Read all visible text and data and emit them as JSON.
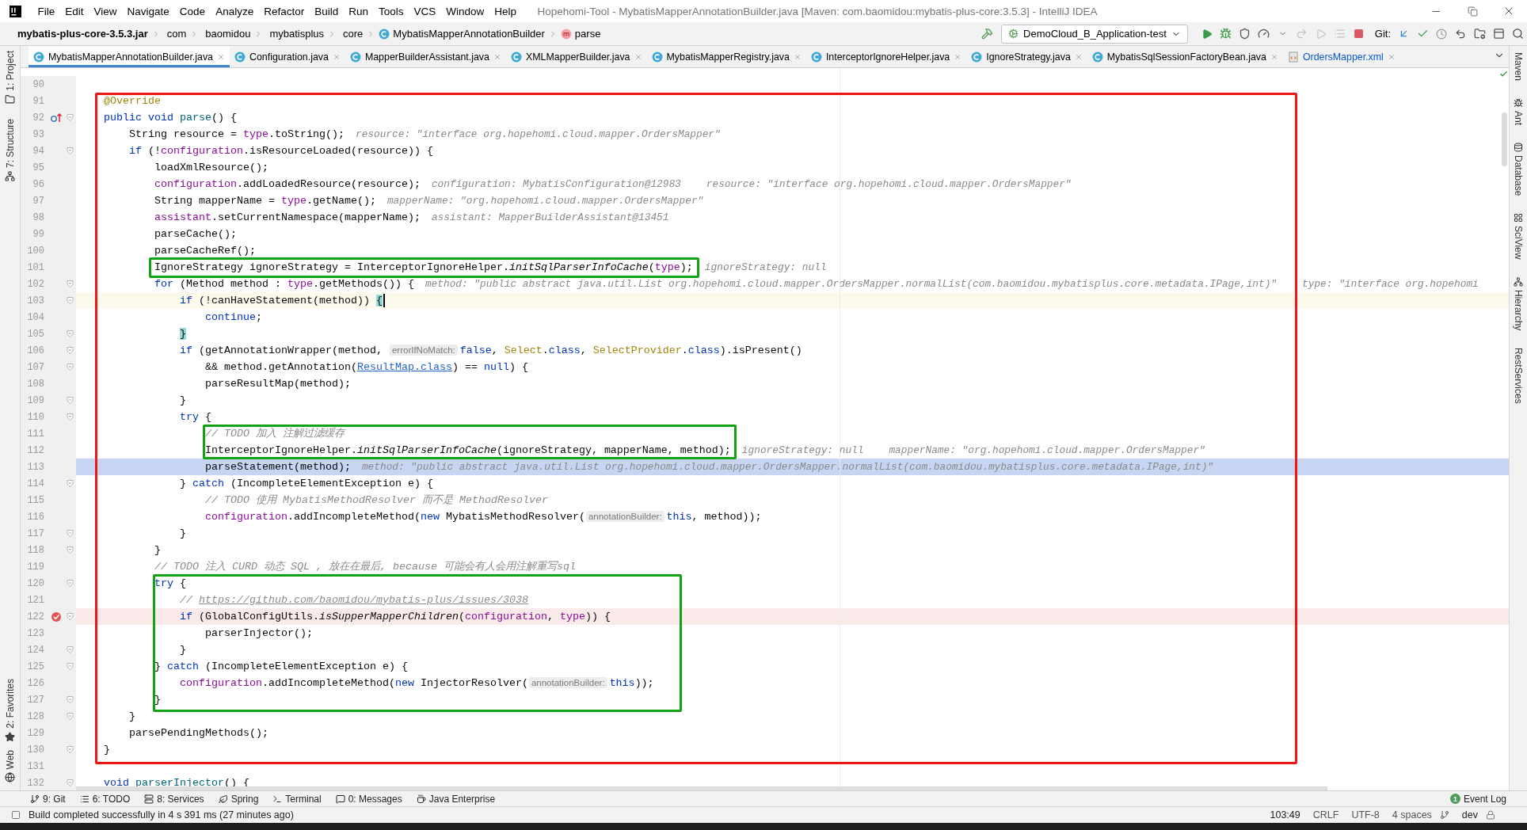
{
  "window": {
    "title": "Hopehomi-Tool - MybatisMapperAnnotationBuilder.java [Maven: com.baomidou:mybatis-plus-core:3.5.3] - IntelliJ IDEA"
  },
  "menu": [
    "File",
    "Edit",
    "View",
    "Navigate",
    "Code",
    "Analyze",
    "Refactor",
    "Build",
    "Run",
    "Tools",
    "VCS",
    "Window",
    "Help"
  ],
  "breadcrumbs": [
    {
      "kind": "jar",
      "text": "mybatis-plus-core-3.5.3.jar"
    },
    {
      "kind": "package",
      "text": "com"
    },
    {
      "kind": "package",
      "text": "baomidou"
    },
    {
      "kind": "package",
      "text": "mybatisplus"
    },
    {
      "kind": "package",
      "text": "core"
    },
    {
      "kind": "class",
      "text": "MybatisMapperAnnotationBuilder"
    },
    {
      "kind": "method",
      "text": "parse"
    }
  ],
  "run_config": {
    "name": "DemoCloud_B_Application-test"
  },
  "vcs_label": "Git:",
  "tabs": [
    {
      "label": "MybatisMapperAnnotationBuilder.java",
      "kind": "class",
      "selected": true,
      "modified": false
    },
    {
      "label": "Configuration.java",
      "kind": "class",
      "selected": false,
      "modified": false
    },
    {
      "label": "MapperBuilderAssistant.java",
      "kind": "class",
      "selected": false,
      "modified": false
    },
    {
      "label": "XMLMapperBuilder.java",
      "kind": "class",
      "selected": false,
      "modified": false
    },
    {
      "label": "MybatisMapperRegistry.java",
      "kind": "class",
      "selected": false,
      "modified": false
    },
    {
      "label": "InterceptorIgnoreHelper.java",
      "kind": "class",
      "selected": false,
      "modified": false
    },
    {
      "label": "IgnoreStrategy.java",
      "kind": "class",
      "selected": false,
      "modified": false
    },
    {
      "label": "MybatisSqlSessionFactoryBean.java",
      "kind": "class",
      "selected": false,
      "modified": false
    },
    {
      "label": "OrdersMapper.xml",
      "kind": "xml",
      "selected": false,
      "modified": true
    }
  ],
  "left_tools_top": [
    {
      "label": "1: Project",
      "kind": "project"
    },
    {
      "label": "7: Structure",
      "kind": "structure"
    }
  ],
  "left_tools_bottom": [
    {
      "label": "2: Favorites",
      "kind": "favorites"
    },
    {
      "label": "Web",
      "kind": "web"
    }
  ],
  "right_tools": [
    {
      "label": "Maven",
      "kind": "maven"
    },
    {
      "label": "Ant",
      "kind": "ant"
    },
    {
      "label": "Database",
      "kind": "database"
    },
    {
      "label": "SciView",
      "kind": "sciview"
    },
    {
      "label": "Hierarchy",
      "kind": "hierarchy"
    },
    {
      "label": "RestServices",
      "kind": "rest"
    }
  ],
  "editor": {
    "lines": [
      {
        "number": "90",
        "fold": false,
        "kind": "plain"
      },
      {
        "number": "91",
        "fold": false,
        "kind": "plain",
        "tokens": [
          {
            "kind": "ann",
            "text": "    @Override"
          }
        ]
      },
      {
        "number": "92",
        "fold": true,
        "kind": "override",
        "tokens": [
          {
            "kind": "kw",
            "text": "    public void "
          },
          {
            "kind": "decl",
            "text": "parse"
          },
          {
            "kind": "plain",
            "text": "() {"
          }
        ]
      },
      {
        "number": "93",
        "fold": false,
        "kind": "plain",
        "tokens": [
          {
            "kind": "plain",
            "text": "        String resource = "
          },
          {
            "kind": "field",
            "text": "type"
          },
          {
            "kind": "plain",
            "text": ".toString();"
          }
        ],
        "hints": [
          "resource: \"interface org.hopehomi.cloud.mapper.OrdersMapper\""
        ]
      },
      {
        "number": "94",
        "fold": true,
        "kind": "plain",
        "tokens": [
          {
            "kind": "kw",
            "text": "        if"
          },
          {
            "kind": "plain",
            "text": " (!"
          },
          {
            "kind": "field",
            "text": "configuration"
          },
          {
            "kind": "plain",
            "text": ".isResourceLoaded(resource)) {"
          }
        ]
      },
      {
        "number": "95",
        "fold": false,
        "kind": "plain",
        "tokens": [
          {
            "kind": "plain",
            "text": "            loadXmlResource();"
          }
        ]
      },
      {
        "number": "96",
        "fold": false,
        "kind": "plain",
        "tokens": [
          {
            "kind": "field",
            "text": "            configuration"
          },
          {
            "kind": "plain",
            "text": ".addLoadedResource(resource);"
          }
        ],
        "hints": [
          "configuration: MybatisConfiguration@12983",
          "resource: \"interface org.hopehomi.cloud.mapper.OrdersMapper\""
        ]
      },
      {
        "number": "97",
        "fold": false,
        "kind": "plain",
        "tokens": [
          {
            "kind": "plain",
            "text": "            String mapperName = "
          },
          {
            "kind": "field",
            "text": "type"
          },
          {
            "kind": "plain",
            "text": ".getName();"
          }
        ],
        "hints": [
          "mapperName: \"org.hopehomi.cloud.mapper.OrdersMapper\""
        ]
      },
      {
        "number": "98",
        "fold": false,
        "kind": "plain",
        "tokens": [
          {
            "kind": "field",
            "text": "            assistant"
          },
          {
            "kind": "plain",
            "text": ".setCurrentNamespace(mapperName);"
          }
        ],
        "hints": [
          "assistant: MapperBuilderAssistant@13451"
        ]
      },
      {
        "number": "99",
        "fold": false,
        "kind": "plain",
        "tokens": [
          {
            "kind": "plain",
            "text": "            parseCache();"
          }
        ]
      },
      {
        "number": "100",
        "fold": false,
        "kind": "plain",
        "tokens": [
          {
            "kind": "plain",
            "text": "            parseCacheRef();"
          }
        ]
      },
      {
        "number": "101",
        "fold": false,
        "kind": "plain",
        "tokens": [
          {
            "kind": "plain",
            "text": "            IgnoreStrategy ignoreStrategy = InterceptorIgnoreHelper."
          },
          {
            "kind": "static",
            "text": "initSqlParserInfoCache"
          },
          {
            "kind": "plain",
            "text": "("
          },
          {
            "kind": "field",
            "text": "type"
          },
          {
            "kind": "plain",
            "text": ");"
          }
        ],
        "hints": [
          "ignoreStrategy: null"
        ]
      },
      {
        "number": "102",
        "fold": true,
        "kind": "plain",
        "tokens": [
          {
            "kind": "kw",
            "text": "            for"
          },
          {
            "kind": "plain",
            "text": " (Method method : "
          },
          {
            "kind": "field",
            "text": "type"
          },
          {
            "kind": "plain",
            "text": ".getMethods()) {"
          }
        ],
        "hints": [
          "method: \"public abstract java.util.List org.hopehomi.cloud.mapper.OrdersMapper.normalList(com.baomidou.mybatisplus.core.metadata.IPage,int)\"",
          "type: \"interface org.hopehomi"
        ]
      },
      {
        "number": "103",
        "fold": true,
        "kind": "caret",
        "tokens": [
          {
            "kind": "kw",
            "text": "                if"
          },
          {
            "kind": "plain",
            "text": " (!canHaveStatement(method)) "
          },
          {
            "kind": "brace",
            "text": "{"
          }
        ]
      },
      {
        "number": "104",
        "fold": false,
        "kind": "plain",
        "tokens": [
          {
            "kind": "kw",
            "text": "                    continue"
          },
          {
            "kind": "plain",
            "text": ";"
          }
        ]
      },
      {
        "number": "105",
        "fold": true,
        "kind": "plain",
        "tokens": [
          {
            "kind": "brace",
            "text": "                }"
          }
        ]
      },
      {
        "number": "106",
        "fold": true,
        "kind": "plain",
        "tokens": [
          {
            "kind": "kw",
            "text": "                if"
          },
          {
            "kind": "plain",
            "text": " (getAnnotationWrapper(method, "
          },
          {
            "kind": "param",
            "text": "errorIfNoMatch:"
          },
          {
            "kind": "kw",
            "text": "false"
          },
          {
            "kind": "plain",
            "text": ", "
          },
          {
            "kind": "ann",
            "text": "Select"
          },
          {
            "kind": "plain",
            "text": "."
          },
          {
            "kind": "kw",
            "text": "class"
          },
          {
            "kind": "plain",
            "text": ", "
          },
          {
            "kind": "ann",
            "text": "SelectProvider"
          },
          {
            "kind": "plain",
            "text": "."
          },
          {
            "kind": "kw",
            "text": "class"
          },
          {
            "kind": "plain",
            "text": ").isPresent()"
          }
        ]
      },
      {
        "number": "107",
        "fold": true,
        "kind": "plain",
        "tokens": [
          {
            "kind": "plain",
            "text": "                    && method.getAnnotation("
          },
          {
            "kind": "link",
            "text": "ResultMap.class"
          },
          {
            "kind": "plain",
            "text": ") == "
          },
          {
            "kind": "kw",
            "text": "null"
          },
          {
            "kind": "plain",
            "text": ") {"
          }
        ]
      },
      {
        "number": "108",
        "fold": false,
        "kind": "plain",
        "tokens": [
          {
            "kind": "plain",
            "text": "                    parseResultMap(method);"
          }
        ]
      },
      {
        "number": "109",
        "fold": true,
        "kind": "plain",
        "tokens": [
          {
            "kind": "plain",
            "text": "                }"
          }
        ]
      },
      {
        "number": "110",
        "fold": true,
        "kind": "plain",
        "tokens": [
          {
            "kind": "kw",
            "text": "                try"
          },
          {
            "kind": "plain",
            "text": " {"
          }
        ]
      },
      {
        "number": "111",
        "fold": false,
        "kind": "plain",
        "tokens": [
          {
            "kind": "comment",
            "text": "                    // TODO 加入 注解过滤缓存"
          }
        ]
      },
      {
        "number": "112",
        "fold": false,
        "kind": "plain",
        "tokens": [
          {
            "kind": "plain",
            "text": "                    InterceptorIgnoreHelper."
          },
          {
            "kind": "static",
            "text": "initSqlParserInfoCache"
          },
          {
            "kind": "plain",
            "text": "(ignoreStrategy, mapperName, method);"
          }
        ],
        "hints": [
          "ignoreStrategy: null",
          "mapperName: \"org.hopehomi.cloud.mapper.OrdersMapper\""
        ]
      },
      {
        "number": "113",
        "fold": false,
        "kind": "exec",
        "tokens": [
          {
            "kind": "plain",
            "text": "                    parseStatement(method);"
          }
        ],
        "hints": [
          "method: \"public abstract java.util.List org.hopehomi.cloud.mapper.OrdersMapper.normalList(com.baomidou.mybatisplus.core.metadata.IPage,int)\""
        ]
      },
      {
        "number": "114",
        "fold": true,
        "kind": "plain",
        "tokens": [
          {
            "kind": "plain",
            "text": "                } "
          },
          {
            "kind": "kw",
            "text": "catch"
          },
          {
            "kind": "plain",
            "text": " (IncompleteElementException e) {"
          }
        ]
      },
      {
        "number": "115",
        "fold": false,
        "kind": "plain",
        "tokens": [
          {
            "kind": "comment",
            "text": "                    // TODO 使用 MybatisMethodResolver 而不是 MethodResolver"
          }
        ]
      },
      {
        "number": "116",
        "fold": false,
        "kind": "plain",
        "tokens": [
          {
            "kind": "field",
            "text": "                    configuration"
          },
          {
            "kind": "plain",
            "text": ".addIncompleteMethod("
          },
          {
            "kind": "kw",
            "text": "new"
          },
          {
            "kind": "plain",
            "text": " MybatisMethodResolver("
          },
          {
            "kind": "param",
            "text": "annotationBuilder:"
          },
          {
            "kind": "kw",
            "text": "this"
          },
          {
            "kind": "plain",
            "text": ", method));"
          }
        ]
      },
      {
        "number": "117",
        "fold": true,
        "kind": "plain",
        "tokens": [
          {
            "kind": "plain",
            "text": "                }"
          }
        ]
      },
      {
        "number": "118",
        "fold": true,
        "kind": "plain",
        "tokens": [
          {
            "kind": "plain",
            "text": "            }"
          }
        ]
      },
      {
        "number": "119",
        "fold": false,
        "kind": "plain",
        "tokens": [
          {
            "kind": "comment",
            "text": "            // TODO 注入 CURD 动态 SQL , 放在在最后, because 可能会有人会用注解重写sql"
          }
        ]
      },
      {
        "number": "120",
        "fold": true,
        "kind": "plain",
        "tokens": [
          {
            "kind": "kw",
            "text": "            try"
          },
          {
            "kind": "plain",
            "text": " {"
          }
        ]
      },
      {
        "number": "121",
        "fold": false,
        "kind": "plain",
        "tokens": [
          {
            "kind": "comment",
            "text": "                // "
          },
          {
            "kind": "comment-link",
            "text": "https://github.com/baomidou/mybatis-plus/issues/3038"
          }
        ]
      },
      {
        "number": "122",
        "fold": true,
        "kind": "breakpoint",
        "tokens": [
          {
            "kind": "kw",
            "text": "                if"
          },
          {
            "kind": "plain",
            "text": " (GlobalConfigUtils."
          },
          {
            "kind": "static",
            "text": "isSupperMapperChildren"
          },
          {
            "kind": "plain",
            "text": "("
          },
          {
            "kind": "field",
            "text": "configuration"
          },
          {
            "kind": "plain",
            "text": ", "
          },
          {
            "kind": "field",
            "text": "type"
          },
          {
            "kind": "plain",
            "text": ")) {"
          }
        ]
      },
      {
        "number": "123",
        "fold": false,
        "kind": "plain",
        "tokens": [
          {
            "kind": "plain",
            "text": "                    parserInjector();"
          }
        ]
      },
      {
        "number": "124",
        "fold": true,
        "kind": "plain",
        "tokens": [
          {
            "kind": "plain",
            "text": "                }"
          }
        ]
      },
      {
        "number": "125",
        "fold": true,
        "kind": "plain",
        "tokens": [
          {
            "kind": "plain",
            "text": "            } "
          },
          {
            "kind": "kw",
            "text": "catch"
          },
          {
            "kind": "plain",
            "text": " (IncompleteElementException e) {"
          }
        ]
      },
      {
        "number": "126",
        "fold": false,
        "kind": "plain",
        "tokens": [
          {
            "kind": "field",
            "text": "                configuration"
          },
          {
            "kind": "plain",
            "text": ".addIncompleteMethod("
          },
          {
            "kind": "kw",
            "text": "new"
          },
          {
            "kind": "plain",
            "text": " InjectorResolver("
          },
          {
            "kind": "param",
            "text": "annotationBuilder:"
          },
          {
            "kind": "kw",
            "text": "this"
          },
          {
            "kind": "plain",
            "text": "));"
          }
        ]
      },
      {
        "number": "127",
        "fold": true,
        "kind": "plain",
        "tokens": [
          {
            "kind": "plain",
            "text": "            }"
          }
        ]
      },
      {
        "number": "128",
        "fold": true,
        "kind": "plain",
        "tokens": [
          {
            "kind": "plain",
            "text": "        }"
          }
        ]
      },
      {
        "number": "129",
        "fold": false,
        "kind": "plain",
        "tokens": [
          {
            "kind": "plain",
            "text": "        parsePendingMethods();"
          }
        ]
      },
      {
        "number": "130",
        "fold": true,
        "kind": "plain",
        "tokens": [
          {
            "kind": "plain",
            "text": "    }"
          }
        ]
      },
      {
        "number": "131",
        "fold": false,
        "kind": "plain"
      },
      {
        "number": "132",
        "fold": true,
        "kind": "plain",
        "tokens": [
          {
            "kind": "kw",
            "text": "    void "
          },
          {
            "kind": "decl",
            "text": "parserInjector"
          },
          {
            "kind": "plain",
            "text": "() {"
          }
        ]
      }
    ]
  },
  "tool_windows": [
    {
      "label": "9: Git",
      "kind": "git"
    },
    {
      "label": "6: TODO",
      "kind": "todo"
    },
    {
      "label": "8: Services",
      "kind": "services"
    },
    {
      "label": "Spring",
      "kind": "spring"
    },
    {
      "label": "Terminal",
      "kind": "terminal"
    },
    {
      "label": "0: Messages",
      "kind": "messages"
    },
    {
      "label": "Java Enterprise",
      "kind": "enterprise"
    }
  ],
  "event_log": {
    "label": "Event Log",
    "count": "1"
  },
  "status": {
    "message": "Build completed successfully in 4 s 391 ms (27 minutes ago)",
    "position": "103:49",
    "line_separator": "CRLF",
    "encoding": "UTF-8",
    "indent": "4 spaces",
    "branch": "dev"
  }
}
